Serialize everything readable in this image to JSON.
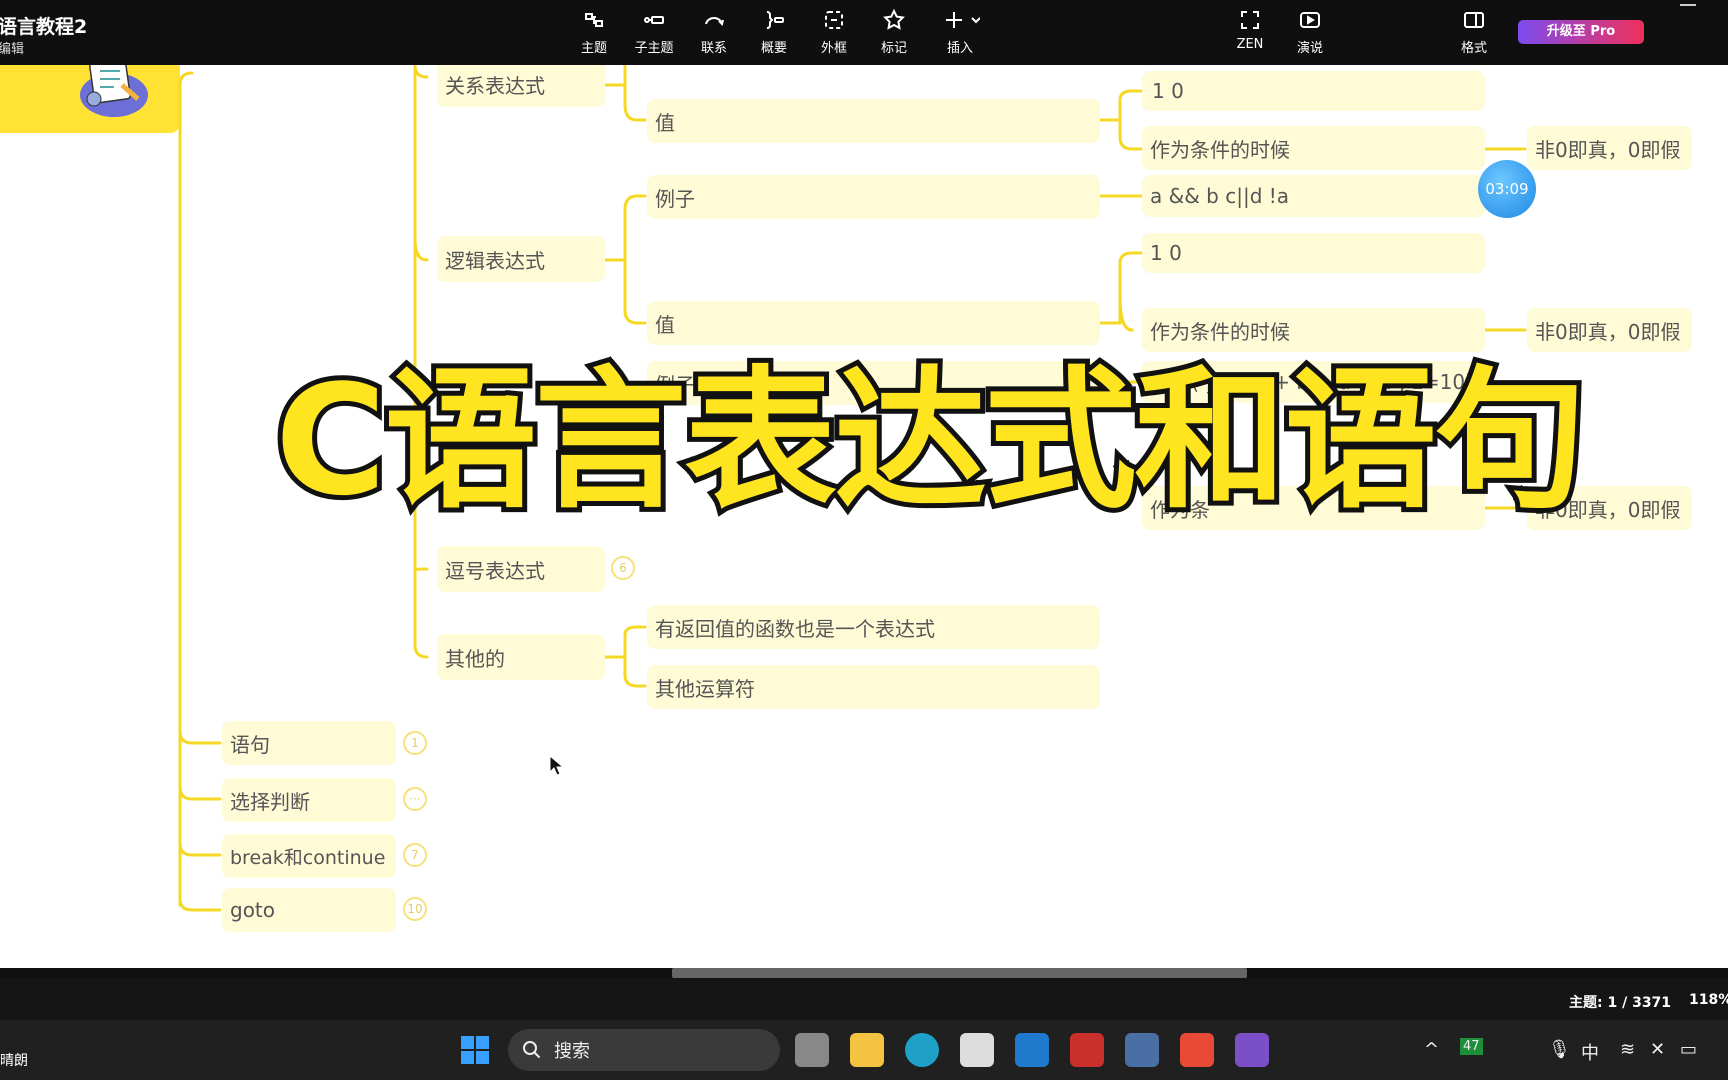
{
  "window": {
    "title": "语言教程2",
    "subtitle": "编辑"
  },
  "toolbar": [
    {
      "label": "主题",
      "icon": "topic-icon"
    },
    {
      "label": "子主题",
      "icon": "subtopic-icon"
    },
    {
      "label": "联系",
      "icon": "relationship-icon"
    },
    {
      "label": "概要",
      "icon": "summary-icon"
    },
    {
      "label": "外框",
      "icon": "boundary-icon"
    },
    {
      "label": "标记",
      "icon": "star-icon"
    },
    {
      "label": "插入",
      "icon": "plus-icon"
    },
    {
      "label": "ZEN",
      "icon": "zen-icon"
    },
    {
      "label": "演说",
      "icon": "pitch-icon"
    },
    {
      "label": "格式",
      "icon": "format-panel-icon"
    }
  ],
  "upgrade_label": "升级至 Pro",
  "timer": "03:09",
  "mindmap": {
    "l1": {
      "relational": "关系表达式",
      "logical": "逻辑表达式",
      "comma": "逗号表达式",
      "other": "其他的"
    },
    "l2": {
      "value1": "值",
      "example1": "例子",
      "value2": "值",
      "example3": "例子",
      "func_expr": "有返回值的函数也是一个表达式",
      "other_ops": "其他运算符"
    },
    "l3": {
      "v10a": "1 0",
      "cond1": "作为条件的时候",
      "logic_example": "a && b  c||d  !a",
      "v10b": "1 0",
      "cond2": "作为条件的时候",
      "assign_example": "x = ( y = (a + b + a > 4 ; z=10)",
      "cond3": "作为条"
    },
    "l4": {
      "truth1": "非0即真，0即假",
      "truth2": "非0即真，0即假",
      "truth3": "非0即真，0即假"
    },
    "main": {
      "statement": "语句",
      "selection": "选择判断",
      "break_continue": "break和continue",
      "goto": "goto"
    },
    "badges": {
      "comma": "6",
      "statement": "1",
      "selection": "···",
      "break_continue": "7",
      "goto": "10"
    }
  },
  "overlay_title": "C语言表达式和语句",
  "status": {
    "topics": "主题: 1 / 3371",
    "zoom": "118%"
  },
  "taskbar": {
    "weather": "晴朗",
    "search_placeholder": "搜索",
    "temp_badge": "47",
    "ime": "中"
  },
  "colors": {
    "branch": "#f5d823",
    "node_bg": "#fffbd6",
    "overlay_fill": "#ffe420",
    "upgrade_gradient_start": "#7d4cf0",
    "upgrade_gradient_end": "#f0305a"
  }
}
